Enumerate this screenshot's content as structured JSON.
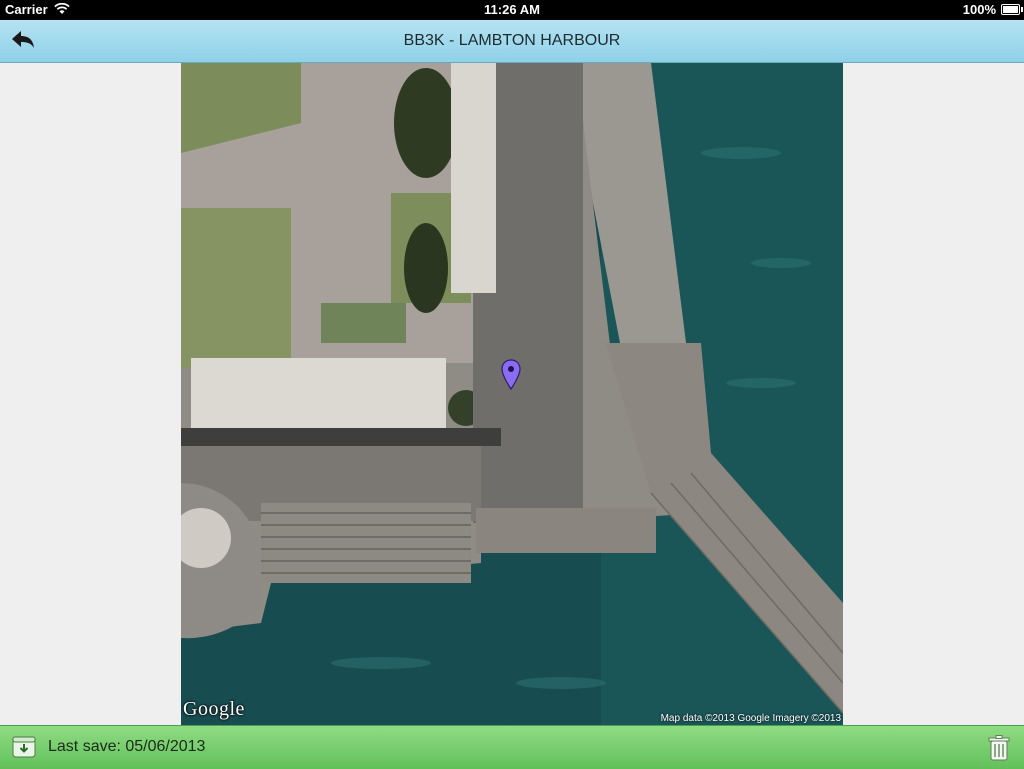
{
  "status_bar": {
    "carrier": "Carrier",
    "time": "11:26 AM",
    "battery": "100%",
    "icons": [
      "wifi-icon",
      "battery-icon"
    ]
  },
  "nav_bar": {
    "title": "BB3K - LAMBTON HARBOUR",
    "back_icon": "back-arrow-icon"
  },
  "map": {
    "logo": "Google",
    "attribution": "Map data ©2013 Google  Imagery ©2013",
    "pin_icon": "location-pin-icon",
    "pin_color": "#8a6cf0"
  },
  "bottom_bar": {
    "save_text": "Last save: 05/06/2013",
    "save_icon": "download-icon",
    "delete_icon": "trash-icon"
  },
  "colors": {
    "nav_accent": "#9fd9ec",
    "bottom_accent": "#72c96a",
    "water": "#164b4f"
  }
}
